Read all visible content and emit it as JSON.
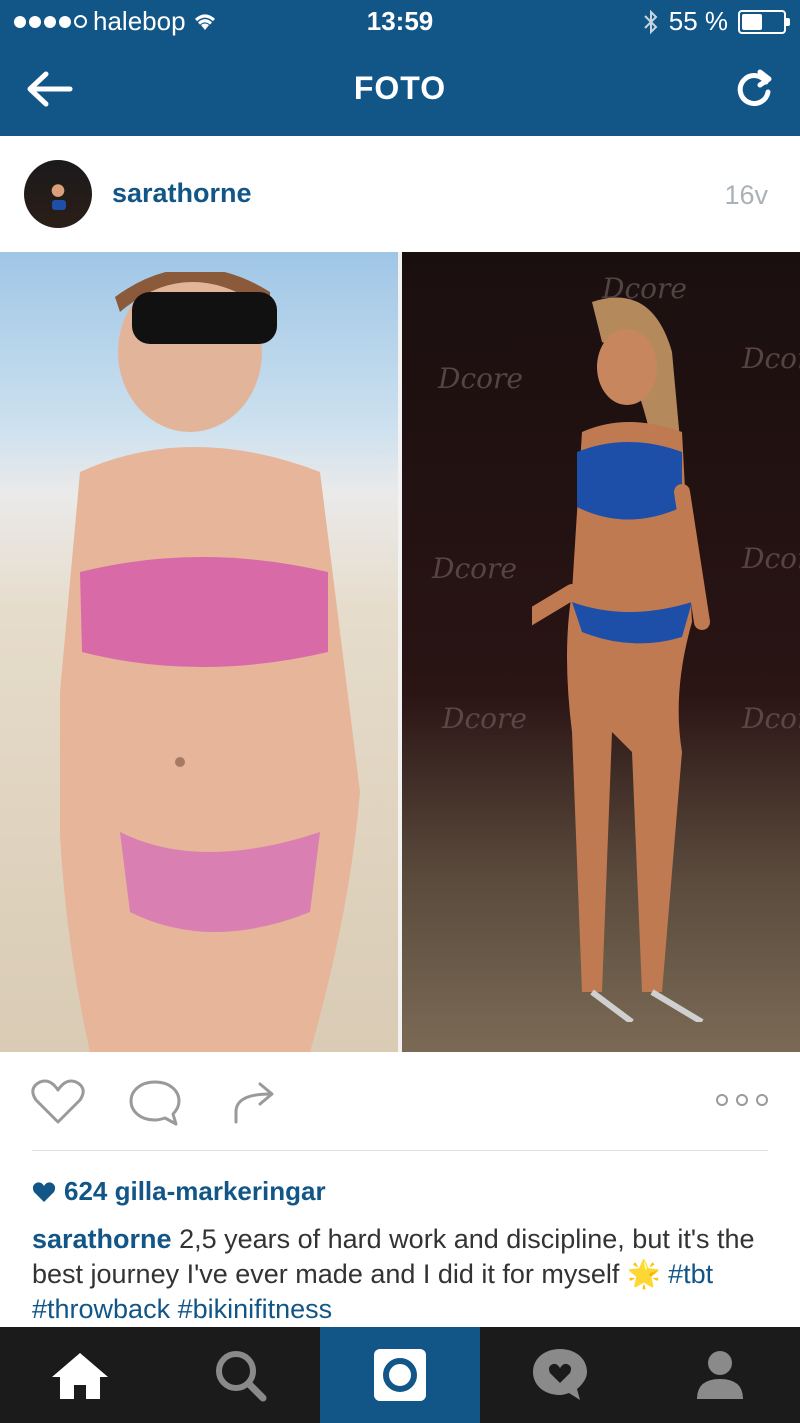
{
  "status_bar": {
    "carrier": "halebop",
    "time": "13:59",
    "battery_text": "55 %",
    "battery_level": 0.55
  },
  "nav": {
    "title": "FOTO"
  },
  "post": {
    "username": "sarathorne",
    "age": "16v",
    "likes_text": "624 gilla-markeringar",
    "caption_user": "sarathorne",
    "caption_text": " 2,5 years of hard work and discipline, but it's the best journey I've ever made and I did it for myself ",
    "caption_emoji": "🌟",
    "hashtags": [
      "#tbt",
      "#throwback",
      "#bikinifitness"
    ]
  },
  "photo": {
    "logo_text": "Dcore"
  },
  "colors": {
    "brand": "#125688",
    "tabbar": "#1b1b1b",
    "muted": "#aab2b8"
  },
  "icons": {
    "back": "arrow-left-icon",
    "refresh": "refresh-icon",
    "like": "heart-icon",
    "comment": "comment-icon",
    "share": "share-icon",
    "more": "more-icon",
    "tabs": [
      "home-icon",
      "search-icon",
      "camera-icon",
      "activity-icon",
      "profile-icon"
    ]
  }
}
